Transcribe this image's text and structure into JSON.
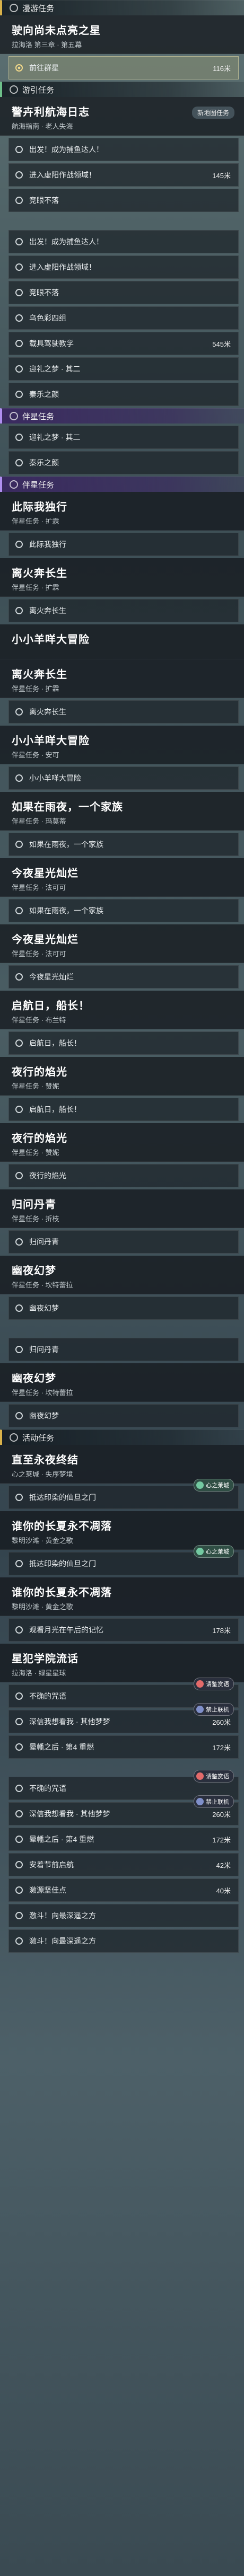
{
  "blocks": [
    {
      "t": "sec",
      "text": "漫游任务",
      "style": "gold"
    },
    {
      "t": "title",
      "title": "驶向尚未点亮之星",
      "sub": "拉海洛 第三章 · 第五幕"
    },
    {
      "t": "row",
      "text": "前往群星",
      "dist": "116米",
      "hi": true
    },
    {
      "t": "sec",
      "text": "游引任务",
      "style": "green"
    },
    {
      "t": "title",
      "title": "警卉利航海日志",
      "sub": "航海指南 · 老人失海",
      "tag": "新地图任务"
    },
    {
      "t": "row",
      "text": "出发！成为捕鱼达人！"
    },
    {
      "t": "row",
      "text": "进入虚阳作战领域！",
      "dist": "145米"
    },
    {
      "t": "row",
      "text": "竞眼不落"
    },
    {
      "t": "gap"
    },
    {
      "t": "row",
      "text": "出发！成为捕鱼达人！"
    },
    {
      "t": "row",
      "text": "进入虚阳作战领域！"
    },
    {
      "t": "row",
      "text": "竞眼不落"
    },
    {
      "t": "row",
      "text": "乌色彩四组"
    },
    {
      "t": "row",
      "text": "载具驾驶教学",
      "dist": "545米"
    },
    {
      "t": "row",
      "text": "迎礼之梦 · 其二"
    },
    {
      "t": "row",
      "text": "秦乐之颜"
    },
    {
      "t": "sec",
      "text": "伴星任务",
      "style": "purple"
    },
    {
      "t": "row",
      "text": "迎礼之梦 · 其二"
    },
    {
      "t": "row",
      "text": "秦乐之颜"
    },
    {
      "t": "sec",
      "text": "伴星任务",
      "style": "purple"
    },
    {
      "t": "title",
      "title": "此际我独行",
      "sub": "伴星任务 · 扩霖"
    },
    {
      "t": "row",
      "text": "此际我独行"
    },
    {
      "t": "title",
      "title": "离火奔长生",
      "sub": "伴星任务 · 扩霖"
    },
    {
      "t": "row",
      "text": "离火奔长生"
    },
    {
      "t": "title",
      "title": "小小羊咩大冒险",
      "sub": ""
    },
    {
      "t": "title",
      "title": "离火奔长生",
      "sub": "伴星任务 · 扩霖"
    },
    {
      "t": "row",
      "text": "离火奔长生"
    },
    {
      "t": "title",
      "title": "小小羊咩大冒险",
      "sub": "伴星任务 · 安可"
    },
    {
      "t": "row",
      "text": "小小羊咩大冒险"
    },
    {
      "t": "title",
      "title": "如果在雨夜，一个家族",
      "sub": "伴星任务 · 玛莫蒂"
    },
    {
      "t": "row",
      "text": "如果在雨夜，一个家族"
    },
    {
      "t": "title",
      "title": "今夜星光灿烂",
      "sub": "伴星任务 · 法可可"
    },
    {
      "t": "row",
      "text": "如果在雨夜，一个家族"
    },
    {
      "t": "title",
      "title": "今夜星光灿烂",
      "sub": "伴星任务 · 法可可"
    },
    {
      "t": "row",
      "text": "今夜星光灿烂"
    },
    {
      "t": "title",
      "title": "启航日，船长！",
      "sub": "伴星任务 · 布兰特"
    },
    {
      "t": "row",
      "text": "启航日，船长！"
    },
    {
      "t": "title",
      "title": "夜行的焰光",
      "sub": "伴星任务 · 赞妮"
    },
    {
      "t": "row",
      "text": "启航日，船长！"
    },
    {
      "t": "title",
      "title": "夜行的焰光",
      "sub": "伴星任务 · 赞妮"
    },
    {
      "t": "row",
      "text": "夜行的焰光"
    },
    {
      "t": "title",
      "title": "归问丹青",
      "sub": "伴星任务 · 折枝"
    },
    {
      "t": "row",
      "text": "归问丹青"
    },
    {
      "t": "title",
      "title": "幽夜幻梦",
      "sub": "伴星任务 · 坎特蕾拉"
    },
    {
      "t": "row",
      "text": "幽夜幻梦"
    },
    {
      "t": "gap"
    },
    {
      "t": "row",
      "text": "归问丹青"
    },
    {
      "t": "title",
      "title": "幽夜幻梦",
      "sub": "伴星任务 · 坎特蕾拉"
    },
    {
      "t": "row",
      "text": "幽夜幻梦"
    },
    {
      "t": "sec",
      "text": "活动任务",
      "style": "gold"
    },
    {
      "t": "title",
      "title": "直至永夜终结",
      "sub": "心之莱城 · 失序梦境"
    },
    {
      "t": "row",
      "text": "抵达印染的仙旦之门",
      "badge": "心之莱城",
      "bstyle": "green"
    },
    {
      "t": "title",
      "title": "谁你的长夏永不凋落",
      "sub": "黎明沙滩 · 黄金之歌"
    },
    {
      "t": "row",
      "text": "抵达印染的仙旦之门",
      "badge": "心之莱城",
      "bstyle": "green"
    },
    {
      "t": "title",
      "title": "谁你的长夏永不凋落",
      "sub": "黎明沙滩 · 黄金之歌"
    },
    {
      "t": "row",
      "text": "观看月光在午后的记忆",
      "dist": "178米"
    },
    {
      "t": "title",
      "title": "星犯学院流话",
      "sub": "拉海洛 · 绿星星球"
    },
    {
      "t": "row",
      "text": "不确的咒语",
      "badge": "请鉴赏语",
      "bstyle": "red"
    },
    {
      "t": "row",
      "text": "深信我想看我 · 其他梦梦",
      "dist": "260米",
      "badge": "禁止联机",
      "bstyle": "blue"
    },
    {
      "t": "row",
      "text": "晕幡之后 · 第4 重燃",
      "dist": "172米"
    },
    {
      "t": "gap"
    },
    {
      "t": "row",
      "text": "不确的咒语",
      "badge": "请鉴赏语",
      "bstyle": "red"
    },
    {
      "t": "row",
      "text": "深信我想看我 · 其他梦梦",
      "dist": "260米",
      "badge": "禁止联机",
      "bstyle": "blue"
    },
    {
      "t": "row",
      "text": "晕幡之后 · 第4 重燃",
      "dist": "172米"
    },
    {
      "t": "row",
      "text": "安着节前启航",
      "dist": "42米"
    },
    {
      "t": "row",
      "text": "激源坚佳点",
      "dist": "40米"
    },
    {
      "t": "row",
      "text": "激斗！向最深遥之方"
    },
    {
      "t": "row",
      "text": "激斗！向最深遥之方"
    }
  ]
}
